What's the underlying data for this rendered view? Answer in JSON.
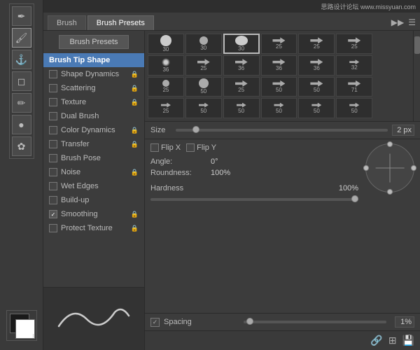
{
  "topbar": {
    "site": "思路设计论坛  www.missyuan.com"
  },
  "tabs": {
    "brush_label": "Brush",
    "brush_presets_label": "Brush Presets",
    "expand_icon": "▶▶",
    "menu_icon": "☰"
  },
  "brush_presets_button": "Brush Presets",
  "brush_list": {
    "items": [
      {
        "label": "Brush Tip Shape",
        "checkbox": false,
        "lock": false,
        "active": true
      },
      {
        "label": "Shape Dynamics",
        "checkbox": false,
        "lock": true,
        "active": false
      },
      {
        "label": "Scattering",
        "checkbox": false,
        "lock": true,
        "active": false
      },
      {
        "label": "Texture",
        "checkbox": false,
        "lock": true,
        "active": false
      },
      {
        "label": "Dual Brush",
        "checkbox": false,
        "lock": false,
        "active": false
      },
      {
        "label": "Color Dynamics",
        "checkbox": false,
        "lock": true,
        "active": false
      },
      {
        "label": "Transfer",
        "checkbox": false,
        "lock": true,
        "active": false
      },
      {
        "label": "Brush Pose",
        "checkbox": false,
        "lock": false,
        "active": false
      },
      {
        "label": "Noise",
        "checkbox": false,
        "lock": true,
        "active": false
      },
      {
        "label": "Wet Edges",
        "checkbox": false,
        "lock": false,
        "active": false
      },
      {
        "label": "Build-up",
        "checkbox": false,
        "lock": false,
        "active": false
      },
      {
        "label": "Smoothing",
        "checkbox": true,
        "lock": true,
        "active": false
      },
      {
        "label": "Protect Texture",
        "checkbox": false,
        "lock": true,
        "active": false
      }
    ]
  },
  "size": {
    "label": "Size",
    "value": "2 px"
  },
  "flip": {
    "flip_x": "Flip X",
    "flip_y": "Flip Y"
  },
  "angle": {
    "label": "Angle:",
    "value": "0°"
  },
  "roundness": {
    "label": "Roundness:",
    "value": "100%"
  },
  "hardness": {
    "label": "Hardness",
    "value": "100%"
  },
  "spacing": {
    "label": "Spacing",
    "value": "1%",
    "checked": true
  },
  "thumbnails": [
    {
      "size": 16,
      "num": "30",
      "type": "circle"
    },
    {
      "size": 12,
      "num": "30",
      "type": "circle"
    },
    {
      "size": 18,
      "num": "30",
      "type": "circle",
      "selected": true
    },
    {
      "size": 10,
      "num": "25",
      "type": "arrow"
    },
    {
      "size": 10,
      "num": "25",
      "type": "arrow"
    },
    {
      "size": 10,
      "num": "25",
      "type": "arrow"
    },
    {
      "size": 8,
      "num": "",
      "type": "scroll"
    },
    {
      "size": 12,
      "num": "36",
      "type": "circle-soft"
    },
    {
      "size": 10,
      "num": "25",
      "type": "arrow"
    },
    {
      "size": 12,
      "num": "36",
      "type": "arrow"
    },
    {
      "size": 12,
      "num": "36",
      "type": "arrow"
    },
    {
      "size": 12,
      "num": "36",
      "type": "arrow"
    },
    {
      "size": 11,
      "num": "32",
      "type": "arrow"
    },
    {
      "size": 8,
      "num": "",
      "type": "scroll"
    },
    {
      "size": 10,
      "num": "25",
      "type": "circle-sm"
    },
    {
      "size": 14,
      "num": "50",
      "type": "circle-sm"
    },
    {
      "size": 10,
      "num": "25",
      "type": "arrow"
    },
    {
      "size": 14,
      "num": "50",
      "type": "arrow"
    },
    {
      "size": 16,
      "num": "50",
      "type": "arrow"
    },
    {
      "size": 16,
      "num": "71",
      "type": "arrow"
    },
    {
      "size": 8,
      "num": "",
      "type": "scroll"
    },
    {
      "size": 10,
      "num": "25",
      "type": "arrow-sm"
    },
    {
      "size": 14,
      "num": "50",
      "type": "arrow-sm"
    },
    {
      "size": 10,
      "num": "50",
      "type": "arrow-sm"
    },
    {
      "size": 12,
      "num": "50",
      "type": "arrow-sm"
    },
    {
      "size": 12,
      "num": "50",
      "type": "arrow-sm"
    },
    {
      "size": 12,
      "num": "50",
      "type": "arrow-sm"
    },
    {
      "size": 8,
      "num": "",
      "type": "scroll"
    }
  ],
  "tools": [
    "✏️",
    "🖌️",
    "⚓",
    "✂️",
    "🖊️",
    "🔘",
    "🌸"
  ],
  "bottom_icons": [
    "🔗",
    "🗂️",
    "📋"
  ]
}
